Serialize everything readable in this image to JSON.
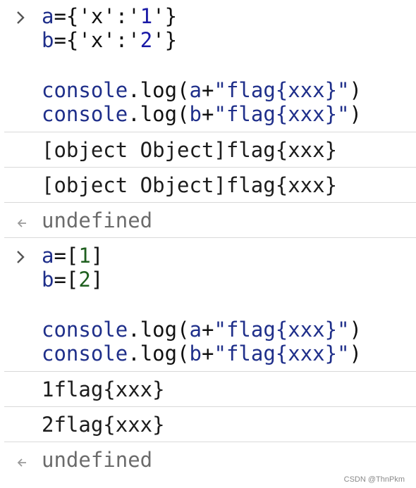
{
  "colors": {
    "identifier": "#1f2f8a",
    "number": "#1f5f1f",
    "string": "#1a1aa6",
    "output": "#1c1c1c",
    "undefined": "#6b6b6b",
    "separator": "#d9d9d9",
    "background": "#ffffff"
  },
  "icons": {
    "input_prompt": "chevron-right-icon",
    "result_marker": "return-arrow-icon"
  },
  "block1": {
    "input": {
      "line1": {
        "a": "a",
        "eq": "={",
        "q1": "'",
        "key": "x",
        "q2": "'",
        "colon": ":",
        "q3": "'",
        "val": "1",
        "q4": "'",
        "close": "}"
      },
      "line2": {
        "b": "b",
        "eq": "={",
        "q1": "'",
        "key": "x",
        "q2": "'",
        "colon": ":",
        "q3": "'",
        "val": "2",
        "q4": "'",
        "close": "}"
      },
      "line3": {
        "console": "console",
        "dot": ".",
        "log": "log",
        "open": "(",
        "var": "a",
        "plus": "+",
        "str": "\"flag{xxx}\"",
        "close": ")"
      },
      "line4": {
        "console": "console",
        "dot": ".",
        "log": "log",
        "open": "(",
        "var": "b",
        "plus": "+",
        "str": "\"flag{xxx}\"",
        "close": ")"
      }
    },
    "outputs": [
      "[object Object]flag{xxx}",
      "[object Object]flag{xxx}"
    ],
    "result": "undefined"
  },
  "block2": {
    "input": {
      "line1": {
        "a": "a",
        "eq": "=[",
        "val": "1",
        "close": "]"
      },
      "line2": {
        "b": "b",
        "eq": "=[",
        "val": "2",
        "close": "]"
      },
      "line3": {
        "console": "console",
        "dot": ".",
        "log": "log",
        "open": "(",
        "var": "a",
        "plus": "+",
        "str": "\"flag{xxx}\"",
        "close": ")"
      },
      "line4": {
        "console": "console",
        "dot": ".",
        "log": "log",
        "open": "(",
        "var": "b",
        "plus": "+",
        "str": "\"flag{xxx}\"",
        "close": ")"
      }
    },
    "outputs": [
      "1flag{xxx}",
      "2flag{xxx}"
    ],
    "result": "undefined"
  },
  "watermark": "CSDN @ThnPkm"
}
